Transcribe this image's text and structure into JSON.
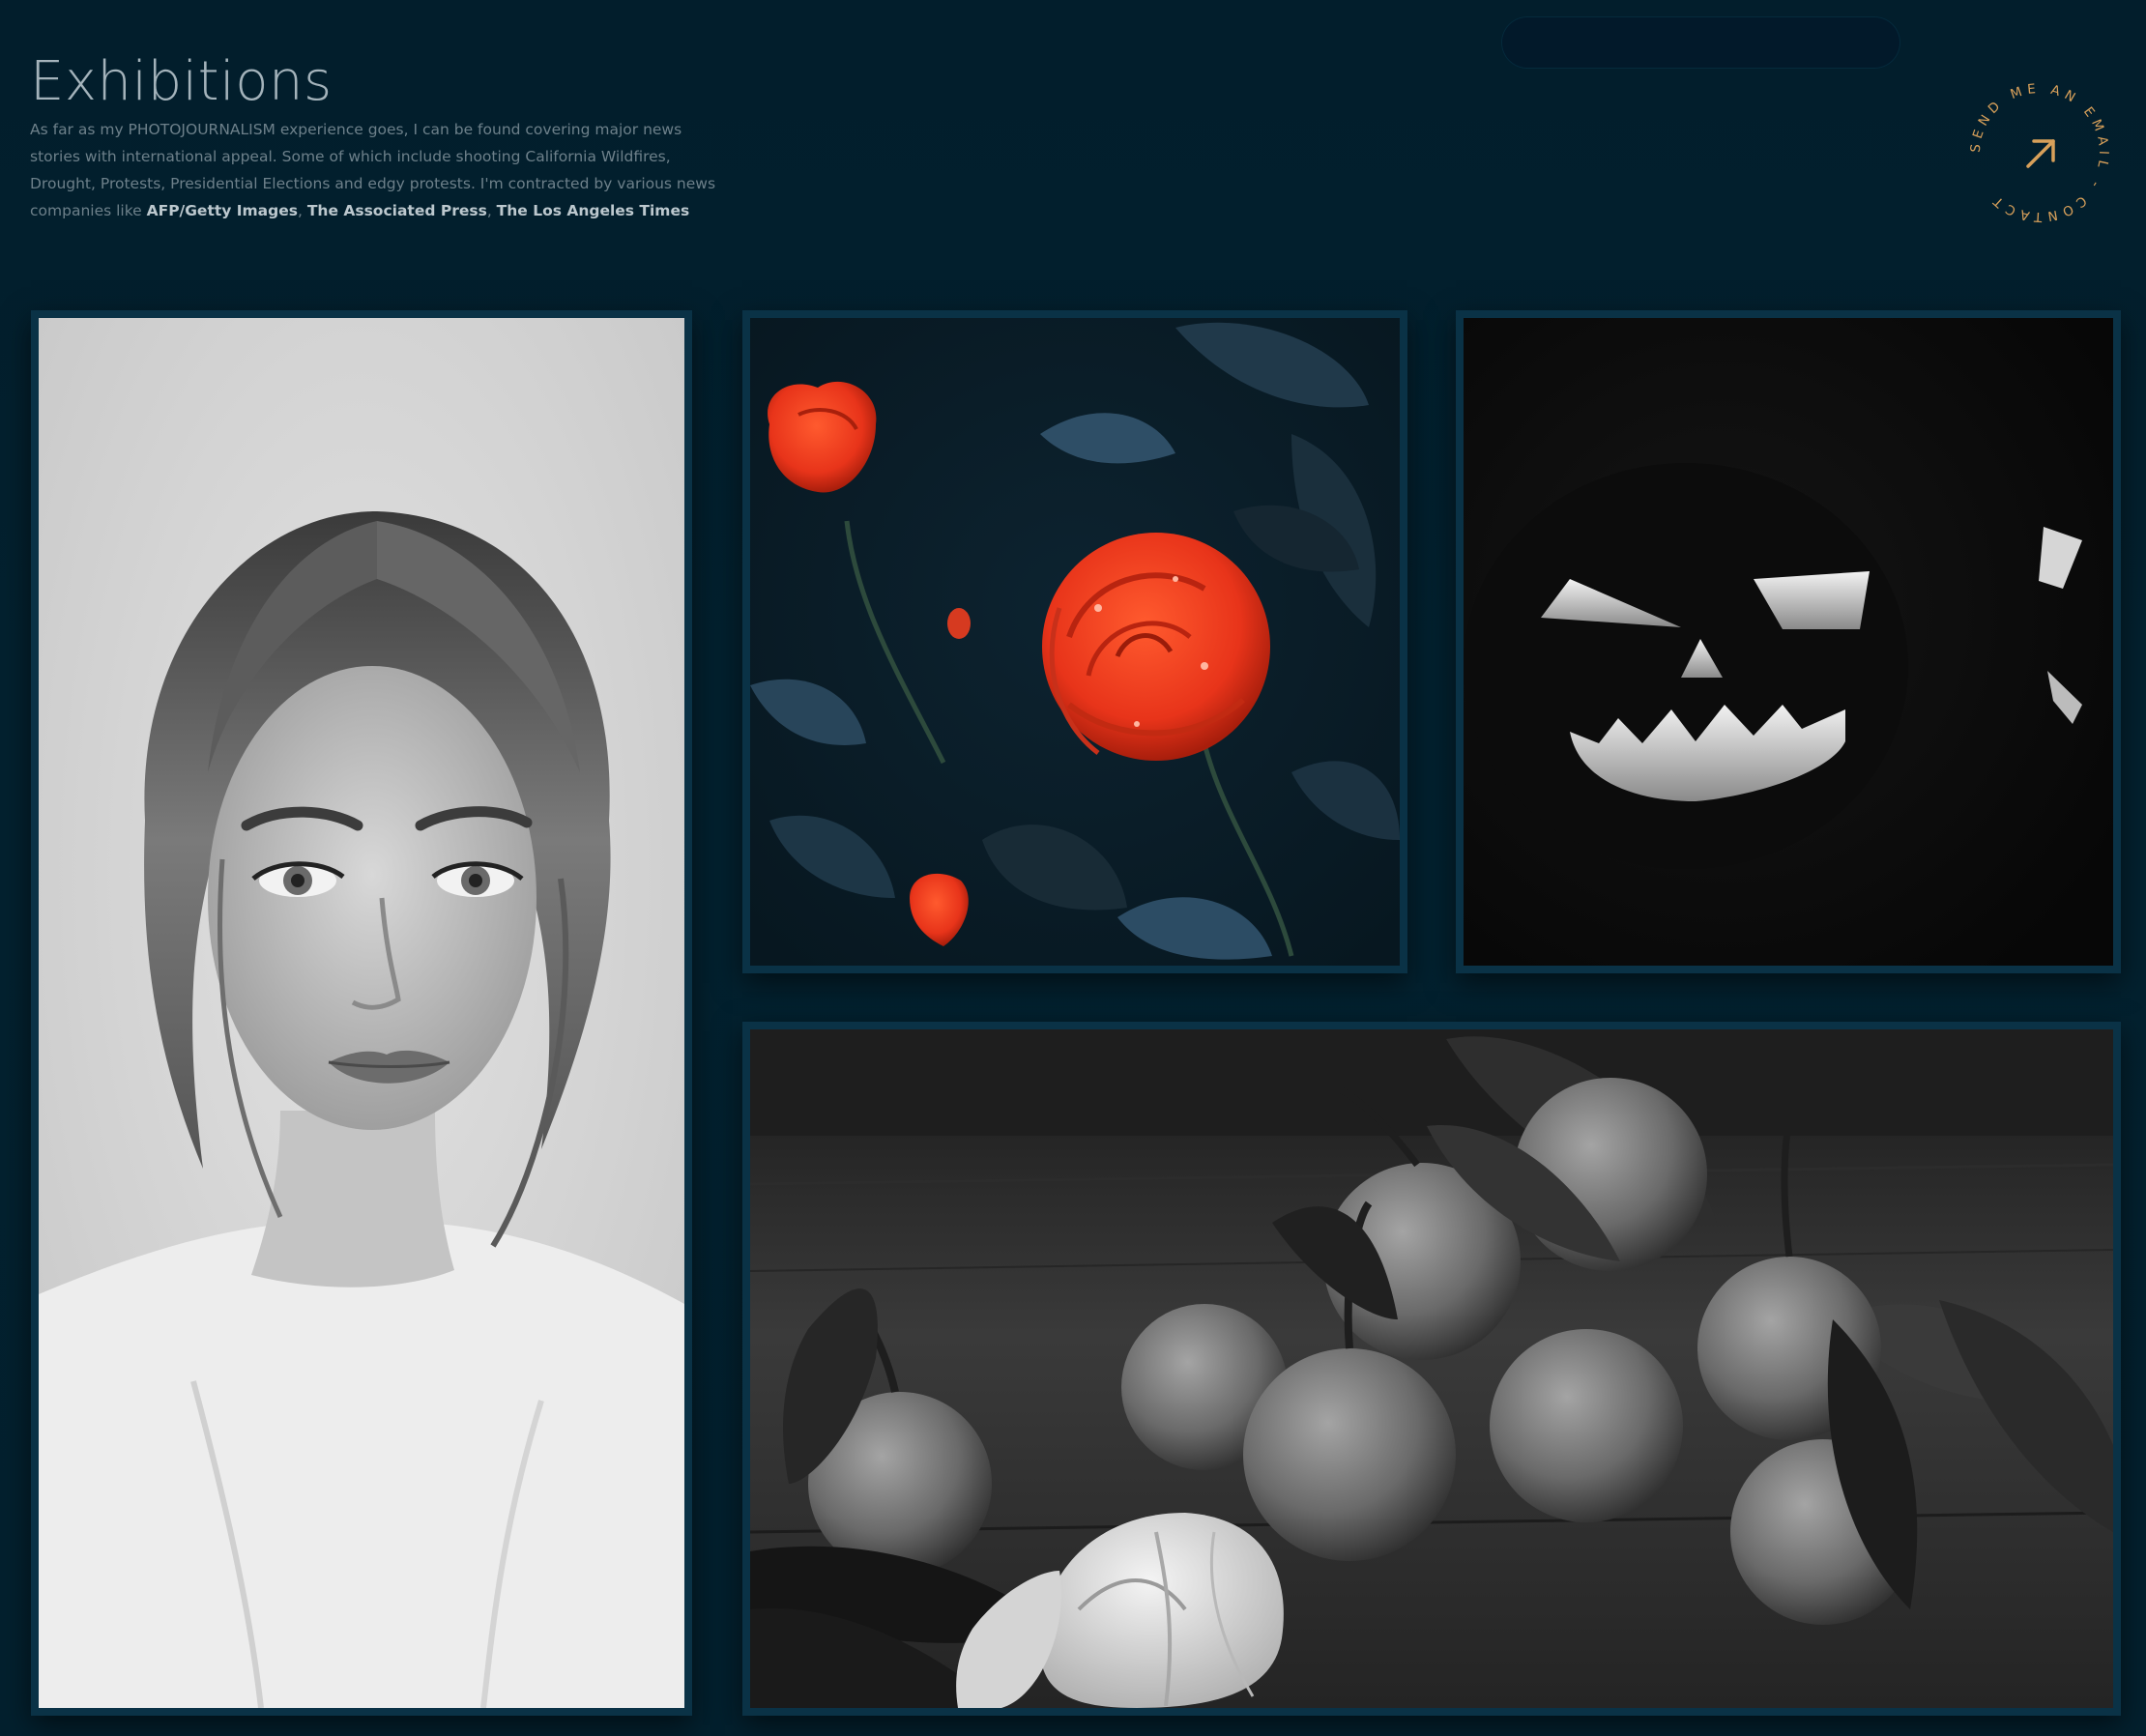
{
  "page": {
    "title": "Exhibitions",
    "intro_text": "As far as my PHOTOJOURNALISM experience goes, I can be found covering major news stories with international appeal. Some of which include shooting California Wildfires, Drought, Protests, Presidential Elections and edgy protests. I'm contracted by various news companies like ",
    "clients": [
      "AFP/Getty Images",
      "The Associated Press",
      "The Los Angeles Times"
    ],
    "client_separator": ", "
  },
  "contact_badge": {
    "ring_text": "SEND ME AN EMAIL - CONTACT",
    "icon": "arrow-up-right-icon",
    "accent_color": "#d8a05a"
  },
  "gallery": {
    "images": [
      {
        "name": "portrait-photo",
        "subject": "black-and-white portrait of a woman"
      },
      {
        "name": "rose-photo",
        "subject": "red roses among dark leaves"
      },
      {
        "name": "pumpkin-photo",
        "subject": "carved jack-o-lantern in the dark"
      },
      {
        "name": "tangerine-photo",
        "subject": "black-and-white tangerines with leaves"
      }
    ]
  },
  "colors": {
    "background": "#03202f",
    "frame_border": "#0a3246",
    "title": "#a4b3bb",
    "body_text": "#6d808a",
    "rose_red": "#e8341a"
  }
}
